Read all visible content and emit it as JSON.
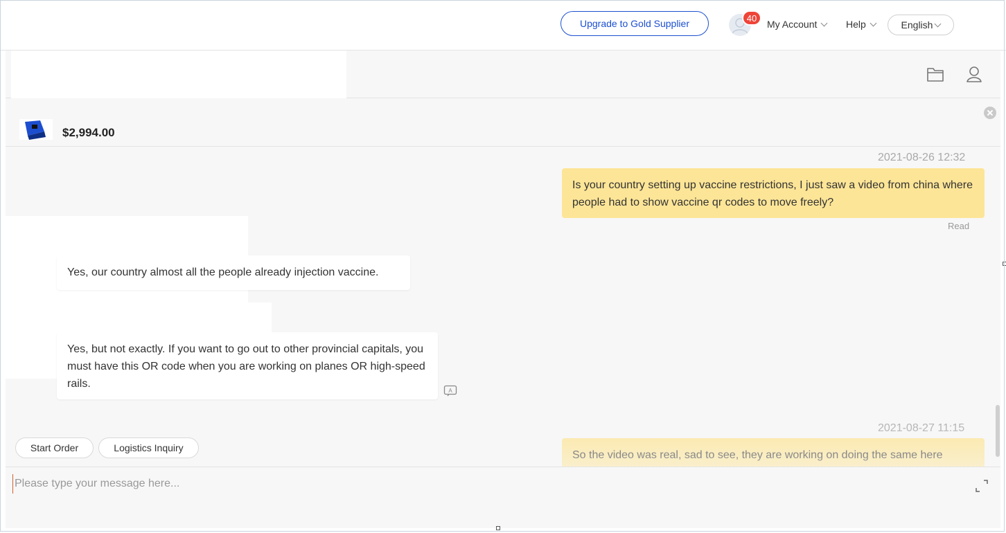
{
  "header": {
    "upgrade_label": "Upgrade to Gold Supplier",
    "notification_count": "40",
    "my_account_label": "My Account",
    "help_label": "Help",
    "language_label": "English"
  },
  "chat_header": {
    "folder_icon": "folder-icon",
    "contact_icon": "user-profile-icon"
  },
  "product": {
    "price": "$2,994.00"
  },
  "messages": [
    {
      "direction": "outgoing",
      "timestamp": "2021-08-26 12:32",
      "text": "Is your country setting up vaccine restrictions, I just saw a video from china where people had to show vaccine qr codes to move freely?",
      "status": "Read"
    },
    {
      "direction": "incoming",
      "text": "Yes, our country almost all the people already injection vaccine."
    },
    {
      "direction": "incoming",
      "text": "Yes, but not exactly. If you want to go out to other provincial capitals, you must have this OR code when you are working on planes OR high-speed rails."
    },
    {
      "direction": "outgoing",
      "timestamp": "2021-08-27 11:15",
      "text": "So the video was real, sad to see, they are working on doing the same here"
    }
  ],
  "quick_actions": [
    "Start Order",
    "Logistics Inquiry"
  ],
  "composer": {
    "placeholder": "Please type your message here..."
  },
  "colors": {
    "accent": "#1b4fd0",
    "badge": "#ef4438",
    "outgoing_bubble": "#fde597",
    "panel_bg": "#f7f7f7"
  }
}
